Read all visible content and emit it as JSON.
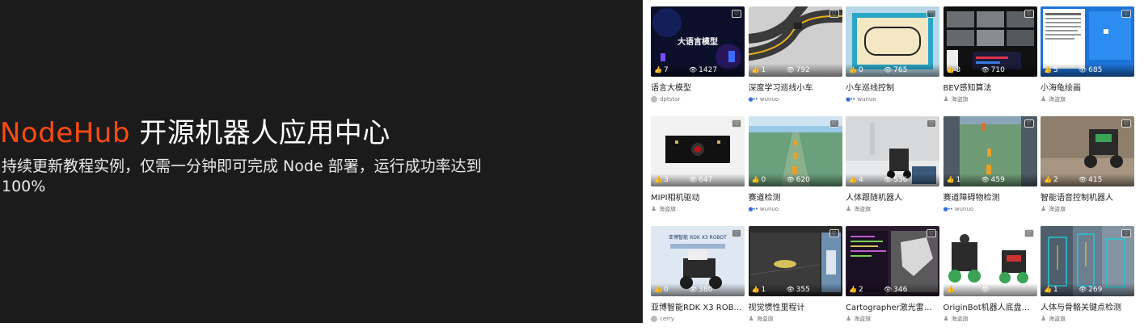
{
  "hero": {
    "brand": "NodeHub",
    "title_rest": " 开源机器人应用中心",
    "subtitle": "持续更新教程实例，仅需一分钟即可完成 Node 部署，运行成功率达到 100%"
  },
  "cards": [
    {
      "title": "语言大模型",
      "likes": "7",
      "views": "1427",
      "author": "dptstar",
      "thumb_text": "大语言模型"
    },
    {
      "title": "深度学习巡线小车",
      "likes": "1",
      "views": "792",
      "author": "wunuo"
    },
    {
      "title": "小车巡线控制",
      "likes": "0",
      "views": "765",
      "author": "wunuo"
    },
    {
      "title": "BEV感知算法",
      "likes": "3",
      "views": "710",
      "author": "海盗旗"
    },
    {
      "title": "小海龟绘画",
      "likes": "5",
      "views": "685",
      "author": "海盗旗"
    },
    {
      "title": "MIPI相机驱动",
      "likes": "3",
      "views": "647",
      "author": "海盗旗"
    },
    {
      "title": "赛道检测",
      "likes": "0",
      "views": "620",
      "author": "wunuo"
    },
    {
      "title": "人体跟随机器人",
      "likes": "4",
      "views": "536",
      "author": "海盗旗"
    },
    {
      "title": "赛道障碍物检测",
      "likes": "1",
      "views": "459",
      "author": "wunuo"
    },
    {
      "title": "智能语音控制机器人",
      "likes": "2",
      "views": "415",
      "author": "海盗旗"
    },
    {
      "title": "亚博智能RDK X3 ROBOT...",
      "likes": "0",
      "views": "380",
      "author": "cerry",
      "thumb_text": "亚博智能 RDK X3 ROBOT"
    },
    {
      "title": "视觉惯性里程计",
      "likes": "1",
      "views": "355",
      "author": "海盗旗"
    },
    {
      "title": "Cartographer激光雷达SL...",
      "likes": "2",
      "views": "346",
      "author": "海盗旗"
    },
    {
      "title": "OriginBot机器人底盘驱动",
      "likes": "",
      "views": "",
      "author": "海盗旗"
    },
    {
      "title": "人体与骨骼关键点检测",
      "likes": "1",
      "views": "269",
      "author": "海盗旗"
    }
  ],
  "colors": {
    "brand": "#fe4a10",
    "hero_bg": "#1c1b1c"
  },
  "icons": {
    "like": "thumb-up-icon",
    "view": "eye-icon",
    "favorite": "heart-icon",
    "author": "person-icon"
  }
}
